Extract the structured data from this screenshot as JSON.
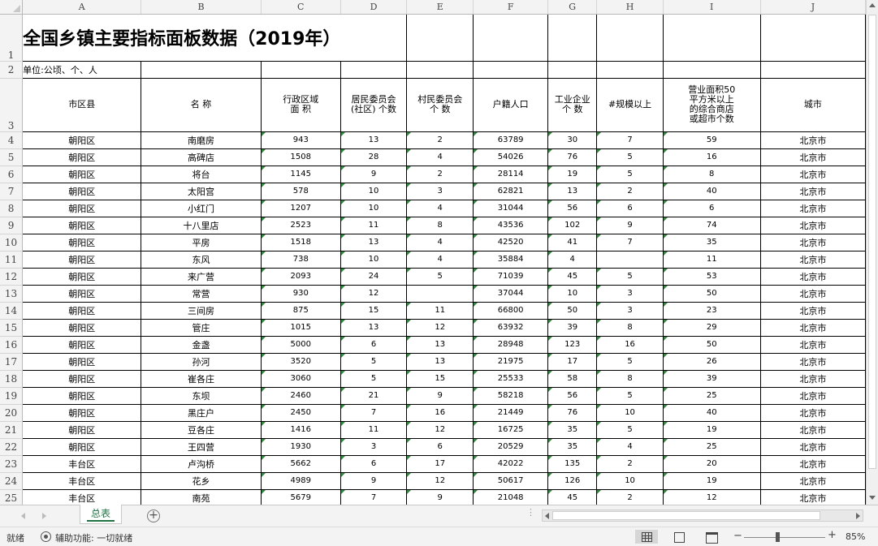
{
  "columns": [
    "A",
    "B",
    "C",
    "D",
    "E",
    "F",
    "G",
    "H",
    "I",
    "J"
  ],
  "title": "全国乡镇主要指标面板数据（2019年）",
  "unit": "单位:公顷、个、人",
  "headers": {
    "a": "市区县",
    "b": "名 称",
    "c": "行政区域\n面 积",
    "d": "居民委员会\n(社区) 个数",
    "e": "村民委员会\n个 数",
    "f": "户籍人口",
    "g": "工业企业\n个 数",
    "h": "#规模以上",
    "i": "营业面积50\n平方米以上\n的综合商店\n或超市个数",
    "j": "城市"
  },
  "rows": [
    {
      "n": "4",
      "a": "朝阳区",
      "b": "南磨房",
      "c": "943",
      "d": "13",
      "e": "2",
      "f": "63789",
      "g": "30",
      "h": "7",
      "i": "59",
      "j": "北京市"
    },
    {
      "n": "5",
      "a": "朝阳区",
      "b": "高碑店",
      "c": "1508",
      "d": "28",
      "e": "4",
      "f": "54026",
      "g": "76",
      "h": "5",
      "i": "16",
      "j": "北京市"
    },
    {
      "n": "6",
      "a": "朝阳区",
      "b": "将台",
      "c": "1145",
      "d": "9",
      "e": "2",
      "f": "28114",
      "g": "19",
      "h": "5",
      "i": "8",
      "j": "北京市"
    },
    {
      "n": "7",
      "a": "朝阳区",
      "b": "太阳宫",
      "c": "578",
      "d": "10",
      "e": "3",
      "f": "62821",
      "g": "13",
      "h": "2",
      "i": "40",
      "j": "北京市"
    },
    {
      "n": "8",
      "a": "朝阳区",
      "b": "小红门",
      "c": "1207",
      "d": "10",
      "e": "4",
      "f": "31044",
      "g": "56",
      "h": "6",
      "i": "6",
      "j": "北京市"
    },
    {
      "n": "9",
      "a": "朝阳区",
      "b": "十八里店",
      "c": "2523",
      "d": "11",
      "e": "8",
      "f": "43536",
      "g": "102",
      "h": "9",
      "i": "74",
      "j": "北京市"
    },
    {
      "n": "10",
      "a": "朝阳区",
      "b": "平房",
      "c": "1518",
      "d": "13",
      "e": "4",
      "f": "42520",
      "g": "41",
      "h": "7",
      "i": "35",
      "j": "北京市"
    },
    {
      "n": "11",
      "a": "朝阳区",
      "b": "东风",
      "c": "738",
      "d": "10",
      "e": "4",
      "f": "35884",
      "g": "4",
      "h": "",
      "i": "11",
      "j": "北京市"
    },
    {
      "n": "12",
      "a": "朝阳区",
      "b": "来广营",
      "c": "2093",
      "d": "24",
      "e": "5",
      "f": "71039",
      "g": "45",
      "h": "5",
      "i": "53",
      "j": "北京市"
    },
    {
      "n": "13",
      "a": "朝阳区",
      "b": "常营",
      "c": "930",
      "d": "12",
      "e": "",
      "f": "37044",
      "g": "10",
      "h": "3",
      "i": "50",
      "j": "北京市"
    },
    {
      "n": "14",
      "a": "朝阳区",
      "b": "三间房",
      "c": "875",
      "d": "15",
      "e": "11",
      "f": "66800",
      "g": "50",
      "h": "3",
      "i": "23",
      "j": "北京市"
    },
    {
      "n": "15",
      "a": "朝阳区",
      "b": "管庄",
      "c": "1015",
      "d": "13",
      "e": "12",
      "f": "63932",
      "g": "39",
      "h": "8",
      "i": "29",
      "j": "北京市"
    },
    {
      "n": "16",
      "a": "朝阳区",
      "b": "金盏",
      "c": "5000",
      "d": "6",
      "e": "13",
      "f": "28948",
      "g": "123",
      "h": "16",
      "i": "50",
      "j": "北京市"
    },
    {
      "n": "17",
      "a": "朝阳区",
      "b": "孙河",
      "c": "3520",
      "d": "5",
      "e": "13",
      "f": "21975",
      "g": "17",
      "h": "5",
      "i": "26",
      "j": "北京市"
    },
    {
      "n": "18",
      "a": "朝阳区",
      "b": "崔各庄",
      "c": "3060",
      "d": "5",
      "e": "15",
      "f": "25533",
      "g": "58",
      "h": "8",
      "i": "39",
      "j": "北京市"
    },
    {
      "n": "19",
      "a": "朝阳区",
      "b": "东坝",
      "c": "2460",
      "d": "21",
      "e": "9",
      "f": "58218",
      "g": "56",
      "h": "5",
      "i": "25",
      "j": "北京市"
    },
    {
      "n": "20",
      "a": "朝阳区",
      "b": "黑庄户",
      "c": "2450",
      "d": "7",
      "e": "16",
      "f": "21449",
      "g": "76",
      "h": "10",
      "i": "40",
      "j": "北京市"
    },
    {
      "n": "21",
      "a": "朝阳区",
      "b": "豆各庄",
      "c": "1416",
      "d": "11",
      "e": "12",
      "f": "16725",
      "g": "35",
      "h": "5",
      "i": "19",
      "j": "北京市"
    },
    {
      "n": "22",
      "a": "朝阳区",
      "b": "王四营",
      "c": "1930",
      "d": "3",
      "e": "6",
      "f": "20529",
      "g": "35",
      "h": "4",
      "i": "25",
      "j": "北京市"
    },
    {
      "n": "23",
      "a": "丰台区",
      "b": "卢沟桥",
      "c": "5662",
      "d": "6",
      "e": "17",
      "f": "42022",
      "g": "135",
      "h": "2",
      "i": "20",
      "j": "北京市"
    },
    {
      "n": "24",
      "a": "丰台区",
      "b": "花乡",
      "c": "4989",
      "d": "9",
      "e": "12",
      "f": "50617",
      "g": "126",
      "h": "10",
      "i": "19",
      "j": "北京市"
    },
    {
      "n": "25",
      "a": "丰台区",
      "b": "南苑",
      "c": "5679",
      "d": "7",
      "e": "9",
      "f": "21048",
      "g": "45",
      "h": "2",
      "i": "12",
      "j": "北京市"
    }
  ],
  "sheet_tab": "总表",
  "add_sheet": "+",
  "status": {
    "ready": "就绪",
    "accessibility": "辅助功能: 一切就绪",
    "zoom_minus": "−",
    "zoom_plus": "+",
    "zoom": "85%"
  }
}
